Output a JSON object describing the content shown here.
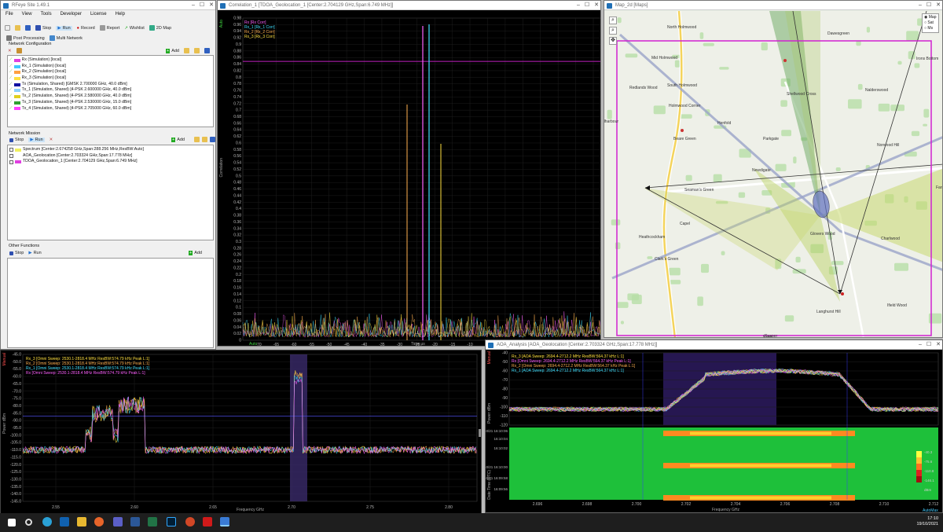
{
  "app": {
    "title": "RFeye Site 1.49.1",
    "menu": [
      "File",
      "View",
      "Tools",
      "Developer",
      "License",
      "Help"
    ],
    "toolbar": {
      "stop": "Stop",
      "run": "Run",
      "record": "Record",
      "report": "Report",
      "wishlist": "Wishlist",
      "map2d": "2D Map"
    },
    "subtoolbar": {
      "post": "Post Processing",
      "multi": "Multi Network"
    },
    "netconfig": {
      "label": "Network Configuration",
      "add": "Add",
      "items": [
        {
          "label": "Rx (Simulation) [local]",
          "color": "#e040e0"
        },
        {
          "label": "Rx_1 (Simulation) [local]",
          "color": "#40c8ff"
        },
        {
          "label": "Rx_2 (Simulation) [local]",
          "color": "#ffa040"
        },
        {
          "label": "Rx_3 (Simulation) [local]",
          "color": "#ffe040"
        },
        {
          "label": "Tx (Simulation, Shared) [GMSK 2.700000 GHz, 40.0 dBm]",
          "color": "#1010a0"
        },
        {
          "label": "Tx_1 (Simulation, Shared) [4-PSK 2.600000 GHz, 40.0 dBm]",
          "color": "#8ad0ff"
        },
        {
          "label": "Tx_2 (Simulation, Shared) [4-PSK 2.580000 GHz, 40.0 dBm]",
          "color": "#e0d020"
        },
        {
          "label": "Tx_3 (Simulation, Shared) [4-PSK 2.530000 GHz, 15.0 dBm]",
          "color": "#30a030"
        },
        {
          "label": "Tx_4 (Simulation, Shared) [4-PSK 2.705000 GHz, 60.0 dBm]",
          "color": "#ff40ff"
        }
      ]
    },
    "mission": {
      "label": "Network Mission",
      "stop": "Stop",
      "run": "Run",
      "add": "Add",
      "items": [
        {
          "label": "Spectrum [Center:2.674258 GHz,Span:288.256 MHz,ResBW:Auto]",
          "color": "#f0f060"
        },
        {
          "label": "AOA_Geolocation [Center:2.703324 GHz,Span:17.778 MHz]",
          "color": "#ffffff"
        },
        {
          "label": "TDOA_Geolocation_1 [Center:2.704129 GHz,Span:6.749 MHz]",
          "color": "#e040e0"
        }
      ]
    },
    "other": {
      "label": "Other Functions",
      "stop": "Stop",
      "run": "Run",
      "add": "Add"
    }
  },
  "correlation": {
    "title": "Correlation_1 [TDOA_Geolocation_1 [Center:2.704129 GHz,Span:6.749 MHz]]",
    "mode": "Auto",
    "ylabel": "Correlation",
    "xlabel": "Time µs",
    "legend": [
      {
        "label": "Rx [Rx Corr]",
        "color": "#ff60ff"
      },
      {
        "label": "Rx_1 [Rx_1 Corr]",
        "color": "#40e0ff"
      },
      {
        "label": "Rx_2 [Rx_2 Corr]",
        "color": "#ffb050"
      },
      {
        "label": "Rx_3 [Rx_3 Corr]",
        "color": "#ffe040"
      }
    ],
    "yticks": [
      "0.98",
      "0.96",
      "0.94",
      "0.92",
      "0.9",
      "0.88",
      "0.86",
      "0.84",
      "0.82",
      "0.8",
      "0.78",
      "0.76",
      "0.74",
      "0.72",
      "0.7",
      "0.68",
      "0.66",
      "0.64",
      "0.62",
      "0.6",
      "0.58",
      "0.56",
      "0.54",
      "0.52",
      "0.5",
      "0.48",
      "0.46",
      "0.44",
      "0.42",
      "0.4",
      "0.38",
      "0.36",
      "0.34",
      "0.32",
      "0.3",
      "0.28",
      "0.26",
      "0.24",
      "0.22",
      "0.2",
      "0.18",
      "0.16",
      "0.14",
      "0.12",
      "0.1",
      "0.08",
      "0.06",
      "0.04",
      "0.02",
      "0"
    ],
    "xticks": [
      "-70",
      "-65",
      "-60",
      "-55",
      "-50",
      "-45",
      "-40",
      "-35",
      "-30",
      "-25",
      "-20",
      "-15",
      "-10",
      "-5",
      "0",
      "5",
      "10",
      "15",
      "20",
      "25"
    ]
  },
  "map": {
    "title": "Map_2d [Maps]",
    "options": [
      "Map",
      "Sat",
      "Ms"
    ],
    "labels": [
      {
        "t": "North Holmwood"
      },
      {
        "t": "Mid Holmwood"
      },
      {
        "t": "South Holmwood"
      },
      {
        "t": "Holmwood Corner"
      },
      {
        "t": "Redlands Wood"
      },
      {
        "t": "Beare Green"
      },
      {
        "t": "Henfold"
      },
      {
        "t": "Parkgate"
      },
      {
        "t": "Newdigate"
      },
      {
        "t": "Capel"
      },
      {
        "t": "Heathcockham"
      },
      {
        "t": "Clark's Green"
      },
      {
        "t": "Charlwood"
      },
      {
        "t": "Norwood Hill"
      },
      {
        "t": "Nalderswood"
      },
      {
        "t": "Shellwood Cross"
      },
      {
        "t": "Dawesgreen"
      },
      {
        "t": "Irons Bottom"
      },
      {
        "t": "Langhurst Hill"
      },
      {
        "t": "Ifield Wood"
      },
      {
        "t": "Russ"
      },
      {
        "t": "dharbour"
      },
      {
        "t": "Farm"
      },
      {
        "t": "Glovers Wood"
      },
      {
        "t": "Seaman's Green"
      },
      {
        "t": "Rusper"
      }
    ]
  },
  "spectrum": {
    "mode": "Manual",
    "ylabel": "Power dBm",
    "xlabel": "Frequency GHz",
    "legend": [
      {
        "label": "Rx_3 [Omni Sweep: 2530.1-2818.4 MHz ResBW:574.79 kHz Peak L:1]",
        "color": "#ffe040"
      },
      {
        "label": "Rx_2 [Omni Sweep: 2530.1-2818.4 MHz ResBW:574.79 kHz Peak L:1]",
        "color": "#ffb050"
      },
      {
        "label": "Rx_1 [Omni Sweep: 2530.1-2818.4 MHz ResBW:574.79 kHz Peak L:1]",
        "color": "#40e0ff"
      },
      {
        "label": "Rx [Omni Sweep: 2530.1-2818.4 MHz ResBW:574.79 kHz Peak L:1]",
        "color": "#ff60ff"
      }
    ],
    "yticks": [
      "-45.0",
      "-50.0",
      "-55.0",
      "-60.0",
      "-65.0",
      "-70.0",
      "-75.0",
      "-80.0",
      "-85.0",
      "-90.0",
      "-95.0",
      "-100.0",
      "-105.0",
      "-110.0",
      "-115.0",
      "-120.0",
      "-125.0",
      "-130.0",
      "-135.0",
      "-140.0",
      "-145.0"
    ],
    "xticks": [
      "2.55",
      "2.60",
      "2.65",
      "2.70",
      "2.75",
      "2.80"
    ]
  },
  "aoa": {
    "title": "AOA_Analysis [AOA_Geolocation [Center:2.703324 GHz,Span:17.778 MHz]]",
    "mode": "Manual",
    "ylabel": "Power dBm",
    "xlabel": "Frequency GHz",
    "automax": "AutoMax",
    "timeaxis": "Date Time (UTC)",
    "legend": [
      {
        "label": "Rx_3 [AOA Sweep: 2694.4-2712.2 MHz ResBW:564.37 kHz L:1]",
        "color": "#ffe040"
      },
      {
        "label": "Rx [Omni Sweep: 2694.4-2712.2 MHz ResBW:564.37 kHz Peak L:1]",
        "color": "#ff60ff"
      },
      {
        "label": "Rx_2 [Omni Sweep: 2694.4-2712.2 MHz ResBW:564.37 kHz Peak L:1]",
        "color": "#ffb050"
      },
      {
        "label": "Rx_1 [AOA Sweep: 2694.4-2712.2 MHz ResBW:564.37 kHz L:1]",
        "color": "#40e0ff"
      }
    ],
    "yticks": [
      "-40",
      "-50",
      "-60",
      "-70",
      "-80",
      "-90",
      "-100",
      "-110",
      "-120"
    ],
    "times": [
      "19/10/21 16:10:06",
      "16:10:04",
      "16:10:02",
      "19/10/21 16:10:00",
      "19/10/21 16:09:58",
      "16:09:56"
    ],
    "xticks": [
      "2.696",
      "2.698",
      "2.700",
      "2.702",
      "2.704",
      "2.706",
      "2.708",
      "2.710",
      "2.712"
    ],
    "colorbar": [
      "-40.3",
      "-75.6",
      "-110.8",
      "-146.1",
      "dBm"
    ]
  },
  "taskbar": {
    "time": "17:10",
    "date": "19/10/2021"
  }
}
